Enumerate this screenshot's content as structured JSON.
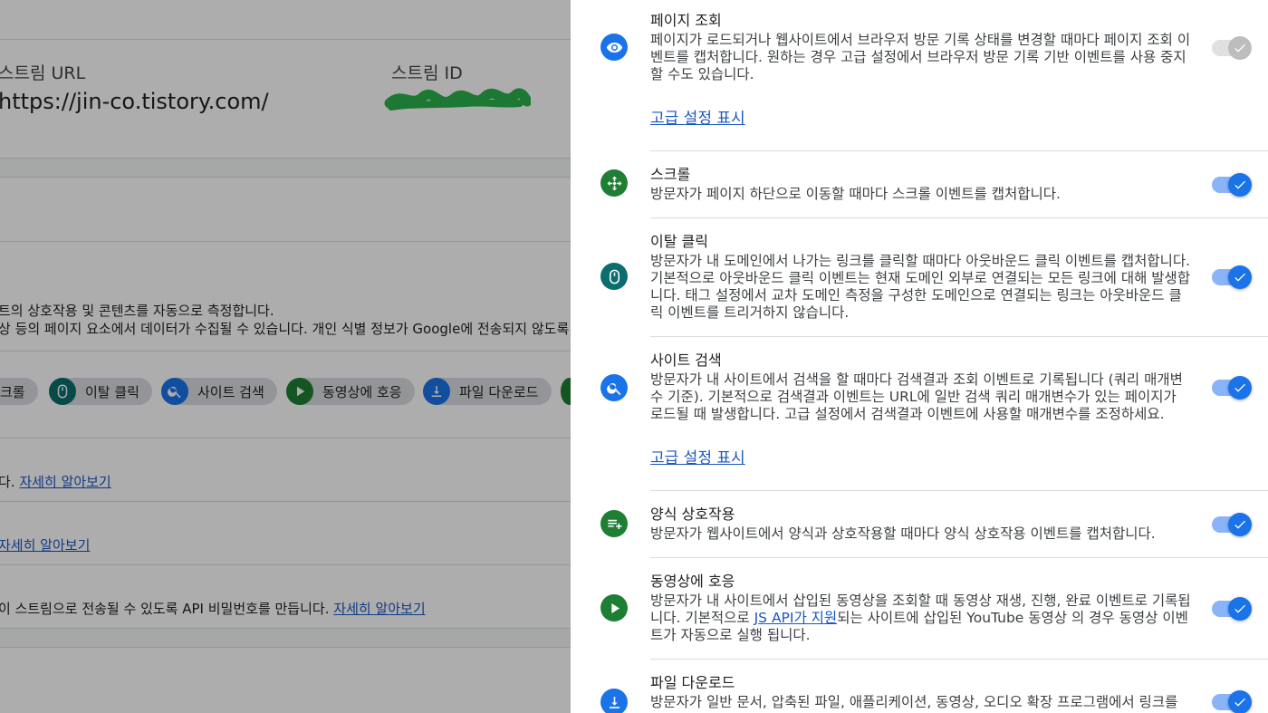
{
  "colors": {
    "blue_icon": "#1a73e8",
    "green_icon": "#1e7e34",
    "teal_icon": "#0b6e6e",
    "toggle_on": "#1a73e8",
    "toggle_off": "#bdbdbd",
    "link": "#1a56c4"
  },
  "background": {
    "stream_url_label": "스트림 URL",
    "stream_url_value": "https://jin-co.tistory.com/",
    "stream_id_label": "스트림 ID",
    "measure_line1": "트의 상호작용 및 콘텐츠를 자동으로 측정합니다.",
    "measure_line2": "상 등의 페이지 요소에서 데이터가 수집될 수 있습니다. 개인 식별 정보가 Google에 전송되지 않도록",
    "chips": [
      {
        "label": "크롤",
        "icon": "scroll-icon"
      },
      {
        "label": "이탈 클릭",
        "icon": "mouse-icon"
      },
      {
        "label": "사이트 검색",
        "icon": "search-icon"
      },
      {
        "label": "동영상에 호응",
        "icon": "play-icon"
      },
      {
        "label": "파일 다운로드",
        "icon": "download-icon"
      }
    ],
    "row1_prefix": "다.",
    "row1_link": "자세히 알아보기",
    "row2_link": "자세히 알아보기",
    "row3_text": "이 스트림으로 전송될 수 있도록 API 비밀번호를 만듭니다.",
    "row3_link": "자세히 알아보기"
  },
  "panel": {
    "events": [
      {
        "title": "페이지 조회",
        "icon": "eye-icon",
        "desc": "페이지가 로드되거나 웹사이트에서 브라우저 방문 기록 상태를 변경할 때마다 페이지 조회 이벤트를 캡처합니다. 원하는 경우 고급 설정에서 브라우저 방문 기록 기반 이벤트를 사용 중지할 수도 있습니다.",
        "advanced_link": "고급 설정 표시",
        "enabled": true,
        "locked": true
      },
      {
        "title": "스크롤",
        "icon": "scroll-icon",
        "desc": "방문자가 페이지 하단으로 이동할 때마다 스크롤 이벤트를 캡처합니다.",
        "enabled": true
      },
      {
        "title": "이탈 클릭",
        "icon": "mouse-icon",
        "desc": "방문자가 내 도메인에서 나가는 링크를 클릭할 때마다 아웃바운드 클릭 이벤트를 캡처합니다. 기본적으로 아웃바운드 클릭 이벤트는 현재 도메인 외부로 연결되는 모든 링크에 대해 발생합니다. 태그 설정에서 교차 도메인 측정을 구성한 도메인으로 연결되는 링크는 아웃바운드 클릭 이벤트를 트리거하지 않습니다.",
        "enabled": true
      },
      {
        "title": "사이트 검색",
        "icon": "search-icon",
        "desc": "방문자가 내 사이트에서 검색을 할 때마다 검색결과 조회 이벤트로 기록됩니다 (쿼리 매개변수 기준). 기본적으로 검색결과 이벤트는 URL에 일반 검색 쿼리 매개변수가 있는 페이지가 로드될 때 발생합니다. 고급 설정에서 검색결과 이벤트에 사용할 매개변수를 조정하세요.",
        "advanced_link": "고급 설정 표시",
        "enabled": true
      },
      {
        "title": "양식 상호작용",
        "icon": "form-icon",
        "desc": "방문자가 웹사이트에서 양식과 상호작용할 때마다 양식 상호작용 이벤트를 캡처합니다.",
        "enabled": true
      },
      {
        "title": "동영상에 호응",
        "icon": "play-icon",
        "desc_before": "방문자가 내 사이트에서 삽입된 동영상을 조회할 때 동영상 재생, 진행, 완료 이벤트로 기록됩니다. 기본적으로 ",
        "desc_link": "JS API가 지원",
        "desc_after": "되는 사이트에 삽입된 YouTube 동영상 의 경우 동영상 이벤트가 자동으로 실행 됩니다.",
        "enabled": true
      },
      {
        "title": "파일 다운로드",
        "icon": "download-icon",
        "desc": "방문자가 일반 문서, 압축된 파일, 애플리케이션, 동영상, 오디오 확장 프로그램에서 링크를",
        "enabled": true
      }
    ]
  }
}
